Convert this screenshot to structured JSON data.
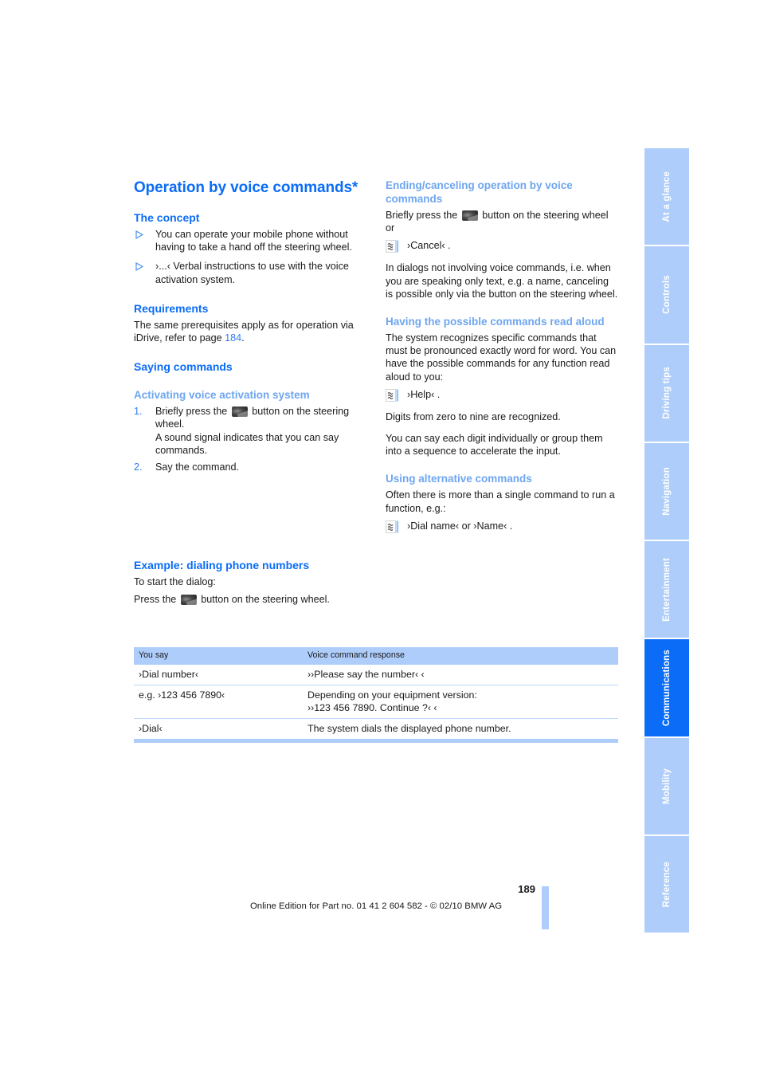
{
  "document": {
    "page_number": "189",
    "edition_line": "Online Edition for Part no. 01 41 2 604 582 - © 02/10 BMW AG"
  },
  "tabs": [
    {
      "label": "At a glance",
      "active": false
    },
    {
      "label": "Controls",
      "active": false
    },
    {
      "label": "Driving tips",
      "active": false
    },
    {
      "label": "Navigation",
      "active": false
    },
    {
      "label": "Entertainment",
      "active": false
    },
    {
      "label": "Communications",
      "active": true
    },
    {
      "label": "Mobility",
      "active": false
    },
    {
      "label": "Reference",
      "active": false
    }
  ],
  "left_column": {
    "title": "Operation by voice commands*",
    "concept": {
      "heading": "The concept",
      "bullets": [
        "You can operate your mobile phone without having to take a hand off the steering wheel.",
        "›...‹ Verbal instructions to use with the voice activation system."
      ]
    },
    "requirements": {
      "heading": "Requirements",
      "text_before": "The same prerequisites apply as for operation via iDrive, refer to page ",
      "page_ref": "184",
      "text_after": "."
    },
    "saying_commands": {
      "heading": "Saying commands",
      "activating": {
        "heading": "Activating voice activation system",
        "steps": [
          {
            "number": "1.",
            "text_before": "Briefly press the ",
            "icon": "steering-wheel-voice-button",
            "text_after": " button on the steering wheel.",
            "extra": "A sound signal indicates that you can say commands."
          },
          {
            "number": "2.",
            "text_before": "Say the command.",
            "icon": "",
            "text_after": "",
            "extra": ""
          }
        ]
      }
    },
    "example": {
      "heading": "Example: dialing phone numbers",
      "intro": "To start the dialog:",
      "press_before": "Press the ",
      "press_after": " button on the steering wheel."
    }
  },
  "right_column": {
    "ending": {
      "heading": "Ending/canceling operation by voice commands",
      "press_before": "Briefly press the ",
      "press_after": " button on the steering wheel or",
      "command": "›Cancel‹ .",
      "note": "In dialogs not involving voice commands, i.e. when you are speaking only text, e.g. a name, canceling is possible only via the button on the steering wheel."
    },
    "read_aloud": {
      "heading": "Having the possible commands read aloud",
      "intro": "The system recognizes specific commands that must be pronounced exactly word for word. You can have the possible commands for any function read aloud to you:",
      "command": "›Help‹ .",
      "digits": "Digits from zero to nine are recognized.",
      "grouping": "You can say each digit individually or group them into a sequence to accelerate the input."
    },
    "alternative": {
      "heading": "Using alternative commands",
      "intro": "Often there is more than a single command to run a function, e.g.:",
      "command": "›Dial name‹  or ›Name‹ ."
    }
  },
  "table": {
    "headers": [
      "You say",
      "Voice command response"
    ],
    "rows": [
      {
        "you_say": "›Dial number‹",
        "response_line1": "››Please say the number‹ ‹",
        "response_line2": ""
      },
      {
        "you_say": "e.g. ›123 456 7890‹",
        "response_line1": "Depending on your equipment version:",
        "response_line2": "››123 456 7890. Continue ?‹ ‹"
      },
      {
        "you_say": "›Dial‹",
        "response_line1": "The system dials the displayed phone number.",
        "response_line2": ""
      }
    ]
  },
  "colors": {
    "heading_blue": "#0a6cf7",
    "subheading_blue": "#6ea6f0",
    "tab_inactive": "#aecdfa",
    "tab_active": "#0a6cf7",
    "table_header": "#aecdfa",
    "link_blue": "#2d7bf5"
  }
}
